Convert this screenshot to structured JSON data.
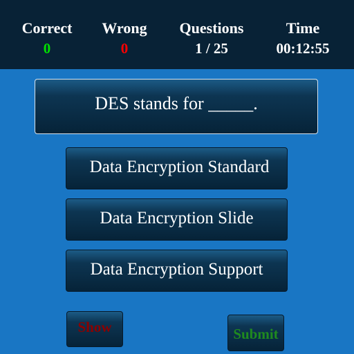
{
  "stats": {
    "correct": {
      "label": "Correct",
      "value": "0",
      "color": "#00e000"
    },
    "wrong": {
      "label": "Wrong",
      "value": "0",
      "color": "#ff0000"
    },
    "questions": {
      "label": "Questions",
      "value": "1 / 25"
    },
    "time": {
      "label": "Time",
      "value": "00:12:55"
    }
  },
  "question": {
    "text": "DES stands for _____."
  },
  "options": [
    {
      "label": "Data Encryption Standard"
    },
    {
      "label": "Data Encryption Slide"
    },
    {
      "label": "Data Encryption Support"
    }
  ],
  "actions": {
    "show_label": "Show",
    "submit_label": "Submit"
  },
  "colors": {
    "background": "#1976c4",
    "topbar": "#082236",
    "show_text": "#8b0000",
    "submit_text": "#1f8a1f"
  }
}
